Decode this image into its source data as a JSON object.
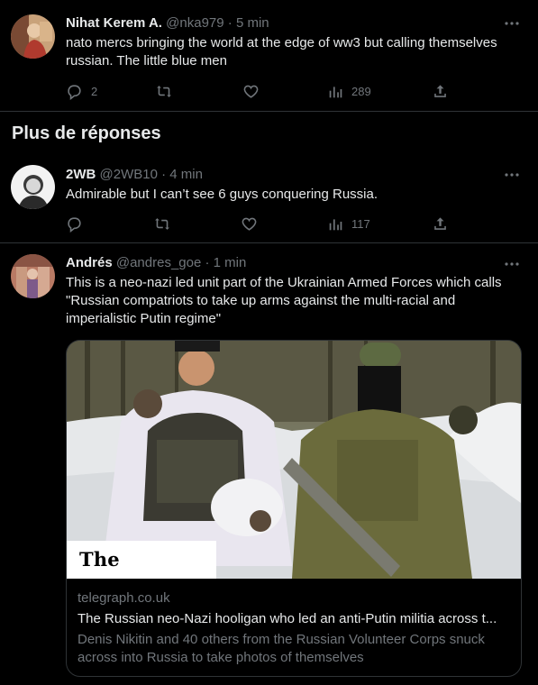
{
  "tweets": [
    {
      "name": "Nihat Kerem A.",
      "handle": "@nka979",
      "sep": "·",
      "time": "5 min",
      "text": "nato mercs bringing the world at the edge of ww3 but calling themselves russian. The little blue men",
      "replies": "2",
      "retweets": "",
      "likes": "",
      "views": "289"
    },
    {
      "name": "2WB",
      "handle": "@2WB10",
      "sep": "·",
      "time": "4 min",
      "text": "Admirable but I can’t see 6 guys conquering Russia.",
      "replies": "",
      "retweets": "",
      "likes": "",
      "views": "117"
    },
    {
      "name": "Andrés",
      "handle": "@andres_goe",
      "sep": "·",
      "time": "1 min",
      "text": "This is a neo-nazi led unit part of the Ukrainian Armed Forces which calls \"Russian compatriots to take up arms against the multi-racial and imperialistic Putin regime\""
    }
  ],
  "section": {
    "title": "Plus de réponses"
  },
  "card": {
    "brand": "The Telegraph",
    "domain": "telegraph.co.uk",
    "title": "The Russian neo-Nazi hooligan who led an anti-Putin militia across t...",
    "description": "Denis Nikitin and 40 others from the Russian Volunteer Corps snuck across into Russia to take photos of themselves"
  },
  "icons": {
    "reply": "reply-icon",
    "retweet": "retweet-icon",
    "like": "heart-icon",
    "views": "views-icon",
    "share": "share-icon",
    "more": "more-icon"
  },
  "colors": {
    "background": "#000000",
    "text": "#e7e9ea",
    "secondary": "#71767b",
    "divider": "#2f3336"
  }
}
